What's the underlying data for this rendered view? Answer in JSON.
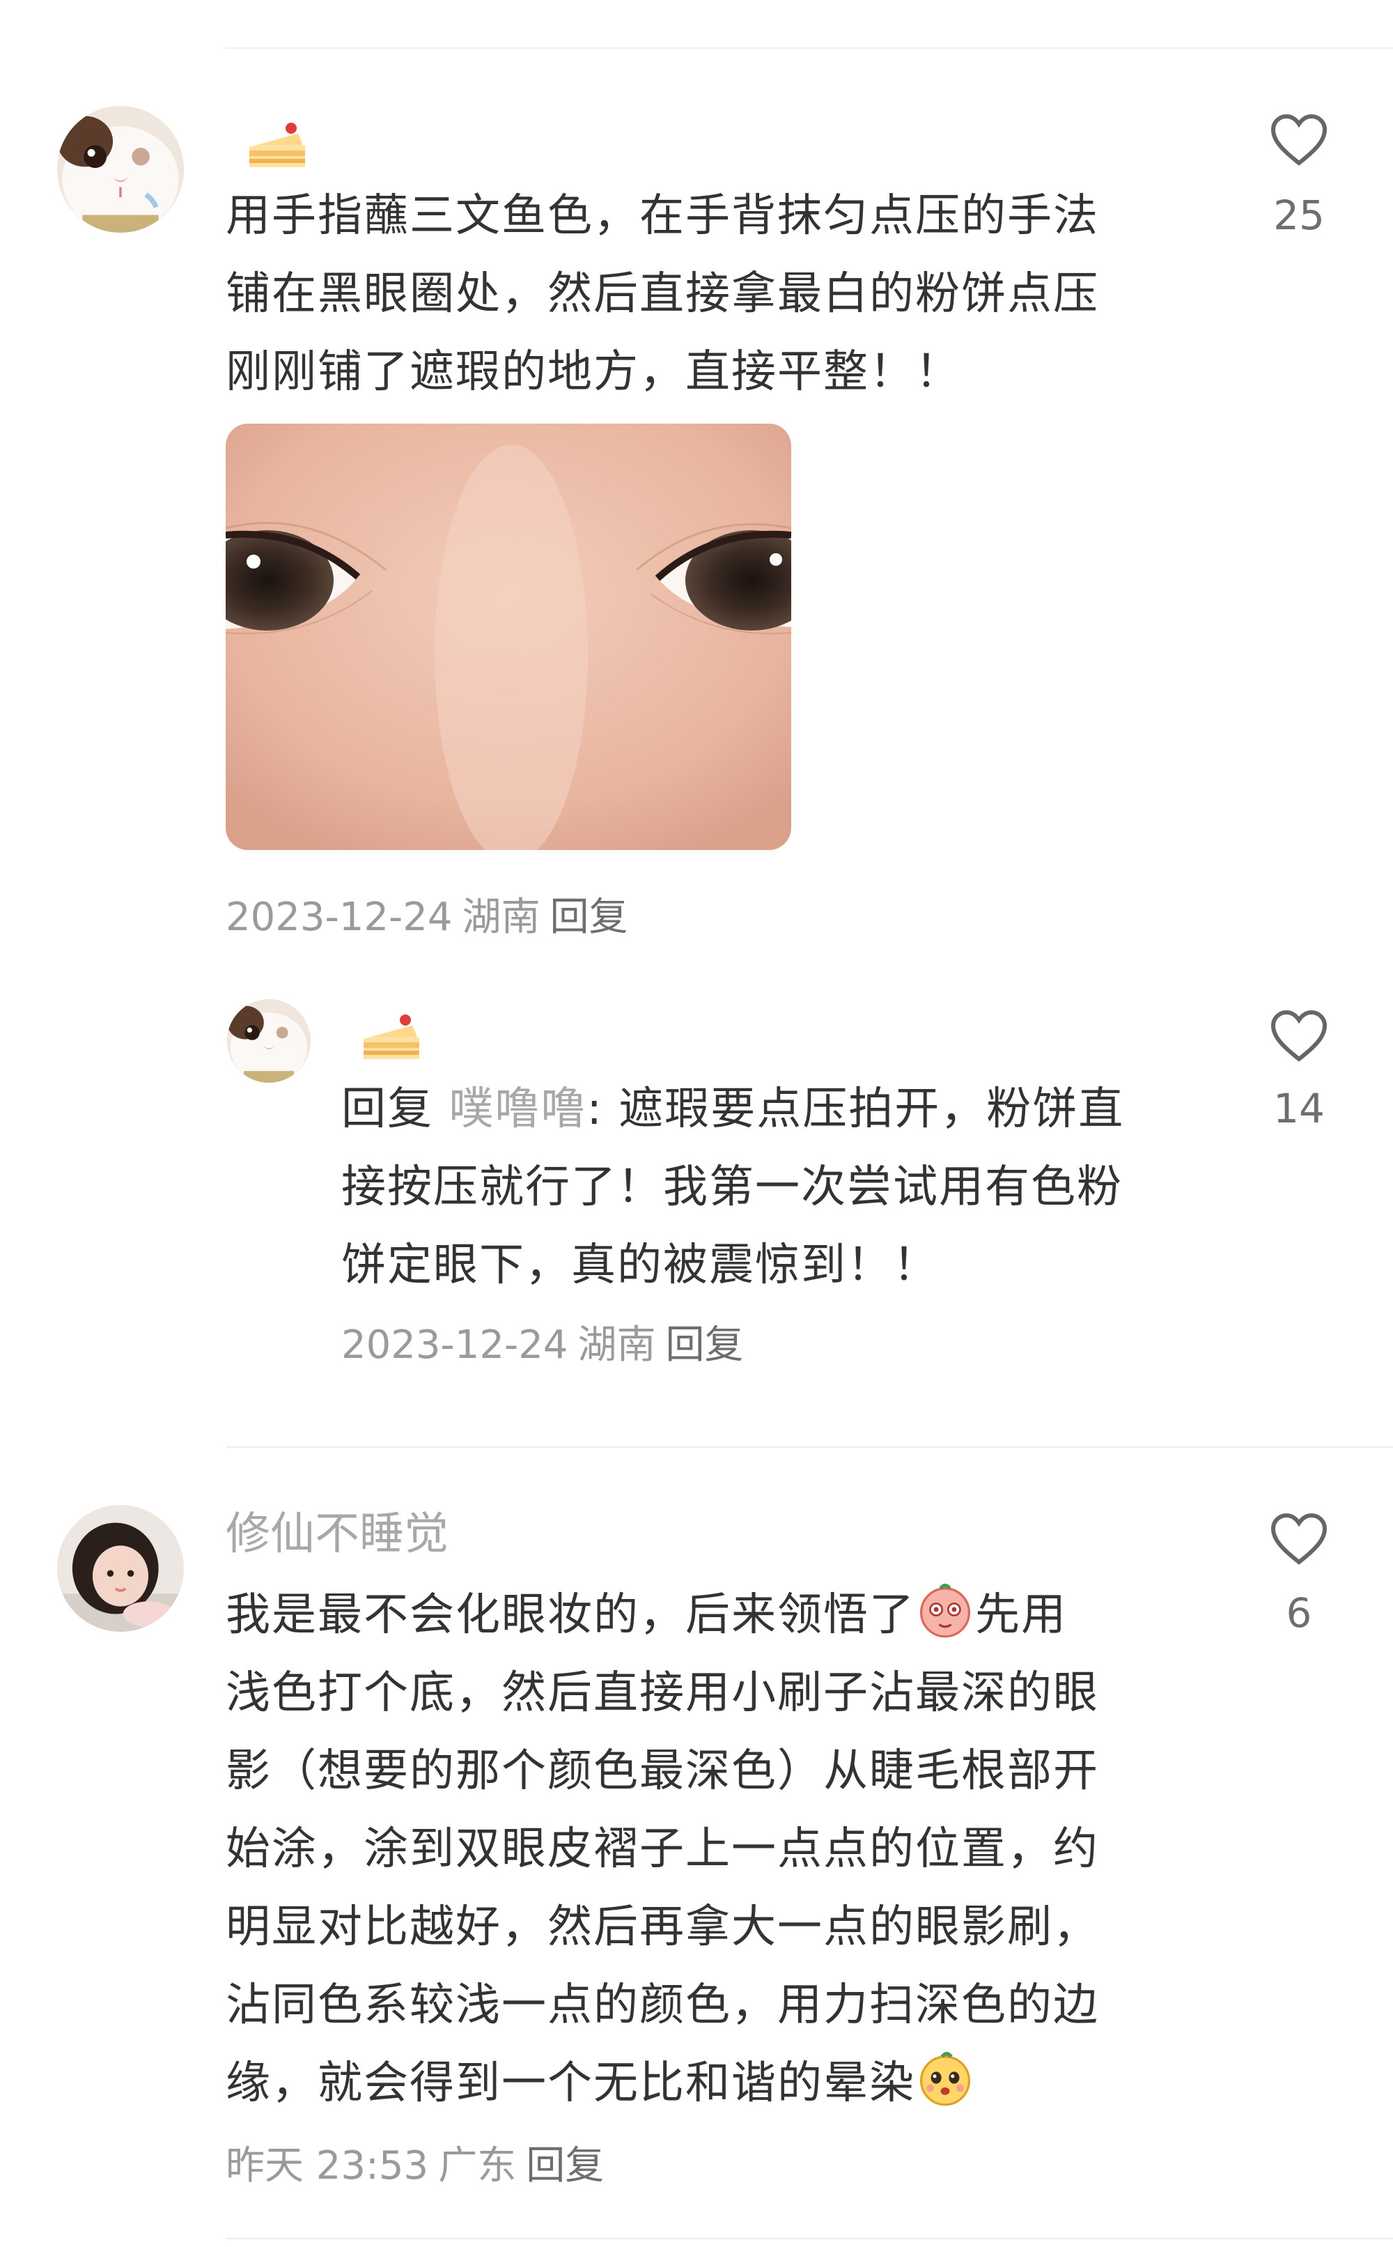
{
  "comments": [
    {
      "username": "",
      "badge_icon": "cake-icon",
      "lines": [
        "用手指蘸三文鱼色，在手背抹匀点压的手法",
        "铺在黑眼圈处，然后直接拿最白的粉饼点压",
        "刚刚铺了遮瑕的地方，直接平整！！"
      ],
      "image_icon": "eye-closeup-photo",
      "date": "2023-12-24",
      "location": "湖南",
      "reply_label": "回复",
      "likes": "25",
      "replies": [
        {
          "username": "",
          "badge_icon": "cake-icon",
          "reply_prefix": "回复",
          "reply_target": "噗噜噜",
          "line1_rest": ": 遮瑕要点压拍开，粉饼直",
          "lines_more": [
            "接按压就行了！我第一次尝试用有色粉",
            "饼定眼下，真的被震惊到！！"
          ],
          "date": "2023-12-24",
          "location": "湖南",
          "reply_label": "回复",
          "likes": "14"
        }
      ]
    },
    {
      "username": "修仙不睡觉",
      "line1_before": "我是最不会化眼妆的，后来领悟了",
      "line1_emoji": "blush-emoji-icon",
      "line1_after": "先用",
      "lines_mid": [
        "浅色打个底，然后直接用小刷子沾最深的眼",
        "影（想要的那个颜色最深色）从睫毛根部开",
        "始涂，涂到双眼皮褶子上一点点的位置，约",
        "明显对比越好，然后再拿大一点的眼影刷，",
        "沾同色系较浅一点的颜色，用力扫深色的边"
      ],
      "last_line_text": "缘，就会得到一个无比和谐的晕染",
      "last_line_emoji": "peach-face-emoji-icon",
      "date": "昨天 23:53",
      "location": "广东",
      "reply_label": "回复",
      "likes": "6"
    }
  ]
}
